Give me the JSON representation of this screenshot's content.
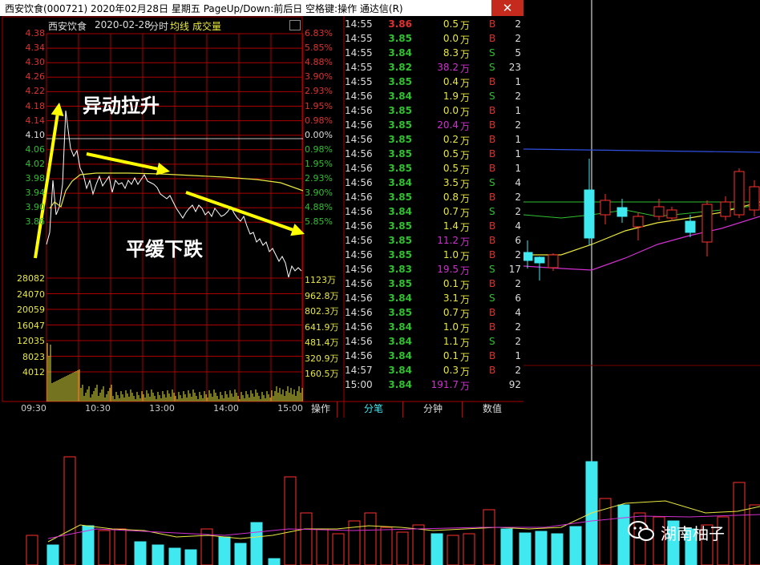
{
  "window": {
    "title": "西安饮食(000721) 2020年02月28日 星期五 PageUp/Down:前后日 空格键:操作 通达信(R)",
    "close": "✕"
  },
  "header": {
    "name": "西安饮食",
    "date": "2020-02-28",
    "view": "分时",
    "avg_label": "均线",
    "vol_label": "成交量"
  },
  "price_axis": {
    "left": [
      "4.38",
      "4.34",
      "4.30",
      "4.26",
      "4.22",
      "4.18",
      "4.14",
      "4.10",
      "4.06",
      "4.02",
      "3.98",
      "3.94",
      "3.90",
      "3.86"
    ],
    "right": [
      "6.83%",
      "5.85%",
      "4.88%",
      "3.90%",
      "2.93%",
      "1.95%",
      "0.98%",
      "0.00%",
      "0.98%",
      "1.95%",
      "2.93%",
      "3.90%",
      "4.88%",
      "5.85%"
    ]
  },
  "volume_axis": {
    "left": [
      "28082",
      "24070",
      "20059",
      "16047",
      "12035",
      "8023",
      "4012"
    ],
    "right": [
      "1123万",
      "962.8万",
      "802.3万",
      "641.9万",
      "481.4万",
      "320.9万",
      "160.5万"
    ]
  },
  "time_axis": [
    "09:30",
    "10:30",
    "13:00",
    "14:00",
    "15:00"
  ],
  "annotations": {
    "rise": "异动拉升",
    "fall": "平缓下跌"
  },
  "tabs": {
    "ops": "操作",
    "ticks": "分笔",
    "minute": "分钟",
    "value": "数值"
  },
  "trades": [
    {
      "time": "14:55",
      "price": "3.86",
      "vol": "0.5",
      "unit": "万",
      "side": "B",
      "count": "2"
    },
    {
      "time": "14:55",
      "price": "3.85",
      "vol": "0.0",
      "unit": "万",
      "side": "B",
      "count": "2"
    },
    {
      "time": "14:55",
      "price": "3.84",
      "vol": "8.3",
      "unit": "万",
      "side": "S",
      "count": "5"
    },
    {
      "time": "14:55",
      "price": "3.82",
      "vol": "38.2",
      "unit": "万",
      "side": "S",
      "count": "23"
    },
    {
      "time": "14:55",
      "price": "3.85",
      "vol": "0.4",
      "unit": "万",
      "side": "B",
      "count": "1"
    },
    {
      "time": "14:56",
      "price": "3.84",
      "vol": "1.9",
      "unit": "万",
      "side": "S",
      "count": "2"
    },
    {
      "time": "14:56",
      "price": "3.85",
      "vol": "0.0",
      "unit": "万",
      "side": "B",
      "count": "1"
    },
    {
      "time": "14:56",
      "price": "3.85",
      "vol": "20.4",
      "unit": "万",
      "side": "B",
      "count": "2"
    },
    {
      "time": "14:56",
      "price": "3.85",
      "vol": "0.2",
      "unit": "万",
      "side": "B",
      "count": "1"
    },
    {
      "time": "14:56",
      "price": "3.85",
      "vol": "0.5",
      "unit": "万",
      "side": "B",
      "count": "1"
    },
    {
      "time": "14:56",
      "price": "3.85",
      "vol": "0.5",
      "unit": "万",
      "side": "B",
      "count": "1"
    },
    {
      "time": "14:56",
      "price": "3.84",
      "vol": "3.5",
      "unit": "万",
      "side": "S",
      "count": "4"
    },
    {
      "time": "14:56",
      "price": "3.85",
      "vol": "0.8",
      "unit": "万",
      "side": "B",
      "count": "2"
    },
    {
      "time": "14:56",
      "price": "3.84",
      "vol": "0.7",
      "unit": "万",
      "side": "S",
      "count": "2"
    },
    {
      "time": "14:56",
      "price": "3.85",
      "vol": "1.4",
      "unit": "万",
      "side": "B",
      "count": "4"
    },
    {
      "time": "14:56",
      "price": "3.85",
      "vol": "11.2",
      "unit": "万",
      "side": "B",
      "count": "6"
    },
    {
      "time": "14:56",
      "price": "3.85",
      "vol": "1.0",
      "unit": "万",
      "side": "B",
      "count": "2"
    },
    {
      "time": "14:56",
      "price": "3.83",
      "vol": "19.5",
      "unit": "万",
      "side": "S",
      "count": "17"
    },
    {
      "time": "14:56",
      "price": "3.85",
      "vol": "0.1",
      "unit": "万",
      "side": "B",
      "count": "2"
    },
    {
      "time": "14:56",
      "price": "3.84",
      "vol": "3.1",
      "unit": "万",
      "side": "S",
      "count": "6"
    },
    {
      "time": "14:56",
      "price": "3.85",
      "vol": "0.7",
      "unit": "万",
      "side": "B",
      "count": "4"
    },
    {
      "time": "14:56",
      "price": "3.84",
      "vol": "1.0",
      "unit": "万",
      "side": "B",
      "count": "2"
    },
    {
      "time": "14:56",
      "price": "3.84",
      "vol": "1.1",
      "unit": "万",
      "side": "S",
      "count": "2"
    },
    {
      "time": "14:56",
      "price": "3.84",
      "vol": "0.1",
      "unit": "万",
      "side": "B",
      "count": "1"
    },
    {
      "time": "14:57",
      "price": "3.84",
      "vol": "0.3",
      "unit": "万",
      "side": "B",
      "count": "2"
    },
    {
      "time": "15:00",
      "price": "3.84",
      "vol": "191.7",
      "unit": "万",
      "side": "",
      "count": "92"
    }
  ],
  "watermark": "湖南柚子",
  "colors": {
    "red": "#e02020",
    "green": "#30c030",
    "yellow": "#e8e840",
    "magenta": "#d030d0",
    "cyan": "#40e8f0",
    "white": "#ffffff"
  }
}
